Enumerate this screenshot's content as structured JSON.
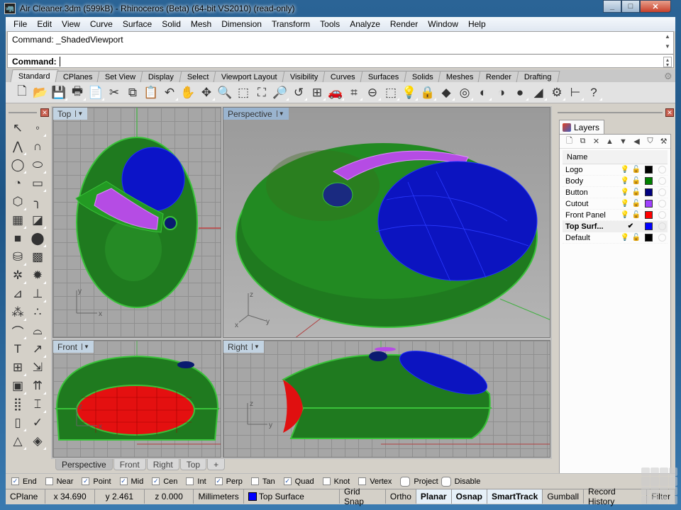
{
  "window": {
    "title": "Air Cleaner.3dm (599kB) - Rhinoceros (Beta) (64-bit VS2010) (read-only)",
    "controls": {
      "minimize": "_",
      "maximize": "□",
      "close": "✕"
    }
  },
  "menu": [
    "File",
    "Edit",
    "View",
    "Curve",
    "Surface",
    "Solid",
    "Mesh",
    "Dimension",
    "Transform",
    "Tools",
    "Analyze",
    "Render",
    "Window",
    "Help"
  ],
  "command": {
    "history": "Command: _ShadedViewport",
    "prompt": "Command:",
    "input_value": ""
  },
  "toolbar_tabs": [
    {
      "label": "Standard",
      "active": true
    },
    {
      "label": "CPlanes"
    },
    {
      "label": "Set View"
    },
    {
      "label": "Display"
    },
    {
      "label": "Select"
    },
    {
      "label": "Viewport Layout"
    },
    {
      "label": "Visibility"
    },
    {
      "label": "Curves"
    },
    {
      "label": "Surfaces"
    },
    {
      "label": "Solids"
    },
    {
      "label": "Meshes"
    },
    {
      "label": "Render"
    },
    {
      "label": "Drafting"
    }
  ],
  "toolbar_icons": [
    {
      "name": "new-icon",
      "glyph": "🗋"
    },
    {
      "name": "open-icon",
      "glyph": "📂"
    },
    {
      "name": "save-icon",
      "glyph": "💾"
    },
    {
      "name": "print-icon",
      "glyph": "🖶"
    },
    {
      "name": "export-icon",
      "glyph": "📄"
    },
    {
      "name": "cut-icon",
      "glyph": "✂"
    },
    {
      "name": "copy-icon",
      "glyph": "⧉"
    },
    {
      "name": "paste-icon",
      "glyph": "📋"
    },
    {
      "name": "undo-icon",
      "glyph": "↶"
    },
    {
      "name": "pan-icon",
      "glyph": "✋"
    },
    {
      "name": "rotate-view-icon",
      "glyph": "✥"
    },
    {
      "name": "zoom-dynamic-icon",
      "glyph": "🔍"
    },
    {
      "name": "zoom-window-icon",
      "glyph": "⬚"
    },
    {
      "name": "zoom-extents-icon",
      "glyph": "⛶"
    },
    {
      "name": "zoom-selected-icon",
      "glyph": "🔎"
    },
    {
      "name": "undo-view-icon",
      "glyph": "↺"
    },
    {
      "name": "four-viewports-icon",
      "glyph": "⊞"
    },
    {
      "name": "car-icon",
      "glyph": "🚗"
    },
    {
      "name": "cplane-icon",
      "glyph": "⌗"
    },
    {
      "name": "circle-point-icon",
      "glyph": "⊖"
    },
    {
      "name": "select-icon",
      "glyph": "⬚"
    },
    {
      "name": "light-bulb-icon",
      "glyph": "💡"
    },
    {
      "name": "lock-icon",
      "glyph": "🔒"
    },
    {
      "name": "layer-icon",
      "glyph": "◆"
    },
    {
      "name": "color-wheel-icon",
      "glyph": "◎"
    },
    {
      "name": "wireframe-sphere-icon",
      "glyph": "◐"
    },
    {
      "name": "shaded-sphere-icon",
      "glyph": "◑"
    },
    {
      "name": "render-sphere-icon",
      "glyph": "●"
    },
    {
      "name": "spotlight-icon",
      "glyph": "◢"
    },
    {
      "name": "options-gear-icon",
      "glyph": "⚙"
    },
    {
      "name": "dimension-icon",
      "glyph": "⊢"
    },
    {
      "name": "help-icon",
      "glyph": "?"
    }
  ],
  "left_tools": [
    {
      "name": "select-arrow-icon",
      "glyph": "↖"
    },
    {
      "name": "point-icon",
      "glyph": "◦"
    },
    {
      "name": "polyline-icon",
      "glyph": "⋀"
    },
    {
      "name": "curve-icon",
      "glyph": "∩"
    },
    {
      "name": "circle-icon",
      "glyph": "◯"
    },
    {
      "name": "ellipse-icon",
      "glyph": "⬭"
    },
    {
      "name": "arc-icon",
      "glyph": "◔"
    },
    {
      "name": "rectangle-icon",
      "glyph": "▭"
    },
    {
      "name": "polygon-icon",
      "glyph": "⬡"
    },
    {
      "name": "fillet-curve-icon",
      "glyph": "╮"
    },
    {
      "name": "surface-from-points-icon",
      "glyph": "▦"
    },
    {
      "name": "extrude-surface-icon",
      "glyph": "◪"
    },
    {
      "name": "box-icon",
      "glyph": "■"
    },
    {
      "name": "sphere-icon",
      "glyph": "⬤"
    },
    {
      "name": "cylinder-icon",
      "glyph": "⛁"
    },
    {
      "name": "mesh-icon",
      "glyph": "▩"
    },
    {
      "name": "boolean-union-icon",
      "glyph": "✲"
    },
    {
      "name": "explode-icon",
      "glyph": "✹"
    },
    {
      "name": "trim-icon",
      "glyph": "⊿"
    },
    {
      "name": "split-icon",
      "glyph": "⊥"
    },
    {
      "name": "group-icon",
      "glyph": "⁂"
    },
    {
      "name": "ungroup-icon",
      "glyph": "∴"
    },
    {
      "name": "fillet-edge-icon",
      "glyph": "⌒"
    },
    {
      "name": "offset-curve-icon",
      "glyph": "⌓"
    },
    {
      "name": "text-icon",
      "glyph": "T"
    },
    {
      "name": "move-icon",
      "glyph": "↗"
    },
    {
      "name": "array-icon",
      "glyph": "⊞"
    },
    {
      "name": "scale-icon",
      "glyph": "⇲"
    },
    {
      "name": "solid-tools-icon",
      "glyph": "▣"
    },
    {
      "name": "project-icon",
      "glyph": "⇈"
    },
    {
      "name": "grid-array-icon",
      "glyph": "⣿"
    },
    {
      "name": "analyze-icon",
      "glyph": "⌶"
    },
    {
      "name": "transform-icon",
      "glyph": "▯"
    },
    {
      "name": "check-icon",
      "glyph": "✓"
    },
    {
      "name": "solid-shapes-icon",
      "glyph": "△"
    },
    {
      "name": "render-tools-icon",
      "glyph": "◈"
    }
  ],
  "viewports": {
    "top": {
      "label": "Top",
      "axis_x": "x",
      "axis_y": "y"
    },
    "perspective": {
      "label": "Perspective",
      "axis_x": "x",
      "axis_y": "y",
      "axis_z": "z"
    },
    "front": {
      "label": "Front",
      "axis_x": "x",
      "axis_y": "z"
    },
    "right": {
      "label": "Right",
      "axis_x": "y",
      "axis_y": "z"
    }
  },
  "viewport_tabs": [
    {
      "label": "Perspective",
      "active": true
    },
    {
      "label": "Front"
    },
    {
      "label": "Right"
    },
    {
      "label": "Top"
    },
    {
      "label": "+"
    }
  ],
  "layers_panel": {
    "tab_label": "Layers",
    "column_name": "Name",
    "tools": [
      "🗋",
      "⧉",
      "✕",
      "▲",
      "▼",
      "◀",
      "⛉",
      "⚒"
    ],
    "rows": [
      {
        "name": "Logo",
        "color": "#000000",
        "current": false
      },
      {
        "name": "Body",
        "color": "#008000",
        "current": false
      },
      {
        "name": "Button",
        "color": "#000080",
        "current": false
      },
      {
        "name": "Cutout",
        "color": "#a040ff",
        "current": false
      },
      {
        "name": "Front Panel",
        "color": "#ff0000",
        "current": false
      },
      {
        "name": "Top Surf...",
        "color": "#0000ff",
        "current": true
      },
      {
        "name": "Default",
        "color": "#000000",
        "current": false
      }
    ],
    "checkmark": "✔"
  },
  "osnaps": [
    {
      "label": "End",
      "checked": true
    },
    {
      "label": "Near",
      "checked": false
    },
    {
      "label": "Point",
      "checked": true
    },
    {
      "label": "Mid",
      "checked": true
    },
    {
      "label": "Cen",
      "checked": true
    },
    {
      "label": "Int",
      "checked": false
    },
    {
      "label": "Perp",
      "checked": true
    },
    {
      "label": "Tan",
      "checked": false
    },
    {
      "label": "Quad",
      "checked": true
    },
    {
      "label": "Knot",
      "checked": false
    },
    {
      "label": "Vertex",
      "checked": false
    }
  ],
  "osnap_buttons": [
    {
      "label": "Project"
    },
    {
      "label": "Disable"
    }
  ],
  "status": {
    "cplane": "CPlane",
    "x": "x 34.690",
    "y": "y 2.461",
    "z": "z 0.000",
    "units": "Millimeters",
    "layer": "Top Surface",
    "layer_color": "#0000ff",
    "toggles": [
      {
        "label": "Grid Snap",
        "on": false
      },
      {
        "label": "Ortho",
        "on": false
      },
      {
        "label": "Planar",
        "on": true
      },
      {
        "label": "Osnap",
        "on": true
      },
      {
        "label": "SmartTrack",
        "on": true
      },
      {
        "label": "Gumball",
        "on": false
      },
      {
        "label": "Record History",
        "on": false
      },
      {
        "label": "Filter",
        "on": false
      }
    ]
  },
  "colors": {
    "body": "#1d7a1d",
    "top_surface": "#0a1aa8",
    "cutout": "#b44ce0",
    "front_panel": "#e01010",
    "button": "#0a1a6a"
  }
}
